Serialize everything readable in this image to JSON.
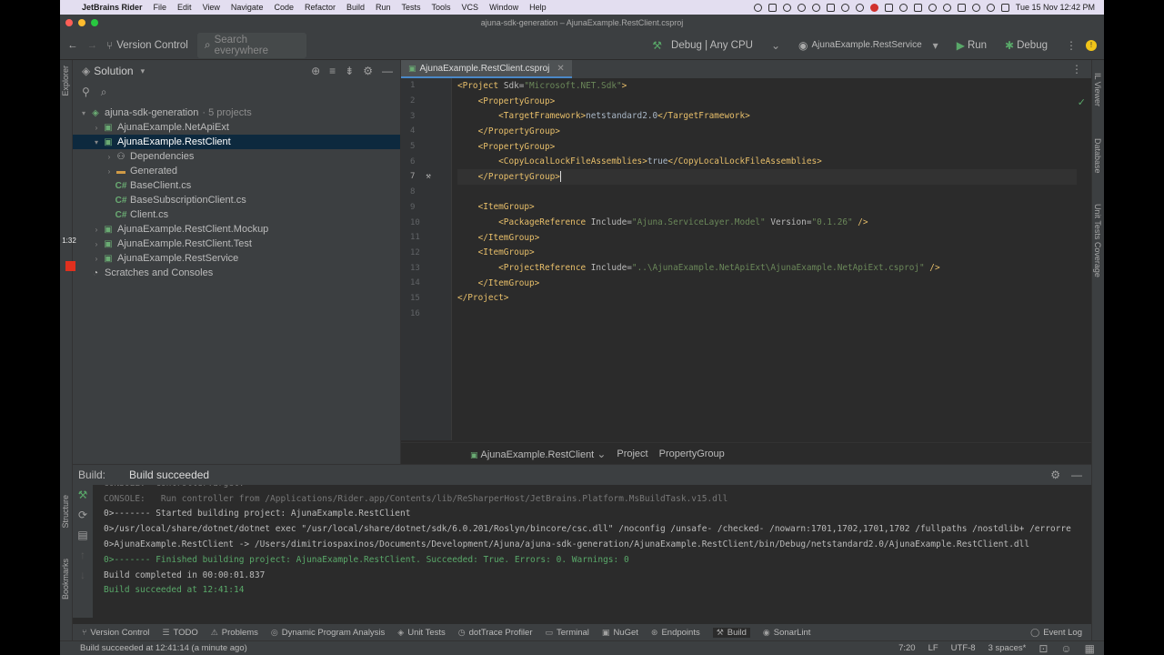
{
  "menubar": {
    "app_name": "JetBrains Rider",
    "items": [
      "File",
      "Edit",
      "View",
      "Navigate",
      "Code",
      "Refactor",
      "Build",
      "Run",
      "Tests",
      "Tools",
      "VCS",
      "Window",
      "Help"
    ],
    "clock": "Tue 15 Nov  12:42 PM"
  },
  "window": {
    "title": "ajuna-sdk-generation – AjunaExample.RestClient.csproj",
    "traffic_colors": [
      "#ff5f57",
      "#febc2e",
      "#28c840"
    ]
  },
  "toolbar": {
    "version_control": "Version Control",
    "search_placeholder": "Search everywhere",
    "config": "Debug | Any CPU",
    "run_target": "AjunaExample.RestService",
    "run_label": "Run",
    "debug_label": "Debug"
  },
  "side_labels": {
    "left_explorer": "Explorer",
    "right": [
      "IL Viewer",
      "Database",
      "Unit Tests Coverage"
    ],
    "build_left": [
      "Structure",
      "Bookmarks"
    ]
  },
  "overlay": {
    "timer": "1:32"
  },
  "project": {
    "header": "Solution",
    "tree": [
      {
        "label": "ajuna-sdk-generation",
        "extra": "· 5 projects",
        "arrow": "▾",
        "icon": "solution-icon",
        "indent": 0
      },
      {
        "label": "AjunaExample.NetApiExt",
        "arrow": "›",
        "icon": "project-icon",
        "indent": 1
      },
      {
        "label": "AjunaExample.RestClient",
        "arrow": "▾",
        "icon": "project-icon",
        "indent": 1,
        "selected": true
      },
      {
        "label": "Dependencies",
        "arrow": "›",
        "icon": "dependencies-icon",
        "indent": 2
      },
      {
        "label": "Generated",
        "arrow": "›",
        "icon": "folder-icon",
        "indent": 2
      },
      {
        "label": "BaseClient.cs",
        "arrow": "",
        "icon": "csharp-file-icon",
        "indent": 2
      },
      {
        "label": "BaseSubscriptionClient.cs",
        "arrow": "",
        "icon": "csharp-file-icon",
        "indent": 2
      },
      {
        "label": "Client.cs",
        "arrow": "",
        "icon": "csharp-file-icon",
        "indent": 2
      },
      {
        "label": "AjunaExample.RestClient.Mockup",
        "arrow": "›",
        "icon": "project-icon",
        "indent": 1
      },
      {
        "label": "AjunaExample.RestClient.Test",
        "arrow": "›",
        "icon": "project-icon",
        "indent": 1
      },
      {
        "label": "AjunaExample.RestService",
        "arrow": "›",
        "icon": "project-icon",
        "indent": 1
      },
      {
        "label": "Scratches and Consoles",
        "arrow": "",
        "icon": "scratches-icon",
        "indent": 0
      }
    ]
  },
  "editor": {
    "tab_label": "AjunaExample.RestClient.csproj",
    "lines": [
      [
        {
          "c": "tag",
          "t": "<Project "
        },
        {
          "c": "attr",
          "t": "Sdk="
        },
        {
          "c": "val",
          "t": "\"Microsoft.NET.Sdk\""
        },
        {
          "c": "tag",
          "t": ">"
        }
      ],
      [
        {
          "c": "txt",
          "t": "    "
        },
        {
          "c": "tag",
          "t": "<PropertyGroup>"
        }
      ],
      [
        {
          "c": "txt",
          "t": "        "
        },
        {
          "c": "tag",
          "t": "<TargetFramework>"
        },
        {
          "c": "txt",
          "t": "netstandard2.0"
        },
        {
          "c": "tag",
          "t": "</TargetFramework>"
        }
      ],
      [
        {
          "c": "txt",
          "t": "    "
        },
        {
          "c": "tag",
          "t": "</PropertyGroup>"
        }
      ],
      [
        {
          "c": "txt",
          "t": "    "
        },
        {
          "c": "tag",
          "t": "<PropertyGroup>"
        }
      ],
      [
        {
          "c": "txt",
          "t": "        "
        },
        {
          "c": "tag",
          "t": "<CopyLocalLockFileAssemblies>"
        },
        {
          "c": "txt",
          "t": "true"
        },
        {
          "c": "tag",
          "t": "</CopyLocalLockFileAssemblies>"
        }
      ],
      [
        {
          "c": "txt",
          "t": "    "
        },
        {
          "c": "tag",
          "t": "</PropertyGroup>"
        }
      ],
      [],
      [
        {
          "c": "txt",
          "t": "    "
        },
        {
          "c": "tag",
          "t": "<ItemGroup>"
        }
      ],
      [
        {
          "c": "txt",
          "t": "        "
        },
        {
          "c": "tag",
          "t": "<PackageReference "
        },
        {
          "c": "attr",
          "t": "Include="
        },
        {
          "c": "val",
          "t": "\"Ajuna.ServiceLayer.Model\""
        },
        {
          "c": "attr",
          "t": " Version="
        },
        {
          "c": "val",
          "t": "\"0.1.26\""
        },
        {
          "c": "tag",
          "t": " />"
        }
      ],
      [
        {
          "c": "txt",
          "t": "    "
        },
        {
          "c": "tag",
          "t": "</ItemGroup>"
        }
      ],
      [
        {
          "c": "txt",
          "t": "    "
        },
        {
          "c": "tag",
          "t": "<ItemGroup>"
        }
      ],
      [
        {
          "c": "txt",
          "t": "        "
        },
        {
          "c": "tag",
          "t": "<ProjectReference "
        },
        {
          "c": "attr",
          "t": "Include="
        },
        {
          "c": "val",
          "t": "\"..\\AjunaExample.NetApiExt\\AjunaExample.NetApiExt.csproj\""
        },
        {
          "c": "tag",
          "t": " />"
        }
      ],
      [
        {
          "c": "txt",
          "t": "    "
        },
        {
          "c": "tag",
          "t": "</ItemGroup>"
        }
      ],
      [
        {
          "c": "tag",
          "t": "</Project>"
        }
      ],
      []
    ],
    "current_line": 7,
    "breadcrumb": [
      "AjunaExample.RestClient",
      "Project",
      "PropertyGroup"
    ]
  },
  "build": {
    "label": "Build:",
    "tab": "Build succeeded",
    "console": [
      {
        "cls": "faded",
        "t": "CONSOLE:  ControllerTarget."
      },
      {
        "cls": "faded",
        "t": "CONSOLE:   Run controller from /Applications/Rider.app/Contents/lib/ReSharperHost/JetBrains.Platform.MsBuildTask.v15.dll"
      },
      {
        "cls": "",
        "t": "0>------- Started building project: AjunaExample.RestClient"
      },
      {
        "cls": "",
        "t": "0>/usr/local/share/dotnet/dotnet exec \"/usr/local/share/dotnet/sdk/6.0.201/Roslyn/bincore/csc.dll\" /noconfig /unsafe- /checked- /nowarn:1701,1702,1701,1702 /fullpaths /nostdlib+ /errorre"
      },
      {
        "cls": "",
        "t": "0>AjunaExample.RestClient -> /Users/dimitriospaxinos/Documents/Development/Ajuna/ajuna-sdk-generation/AjunaExample.RestClient/bin/Debug/netstandard2.0/AjunaExample.RestClient.dll"
      },
      {
        "cls": "green",
        "t": "0>------- Finished building project: AjunaExample.RestClient. Succeeded: True. Errors: 0. Warnings: 0"
      },
      {
        "cls": "",
        "t": "Build completed in 00:00:01.837"
      },
      {
        "cls": "green",
        "t": "Build succeeded at 12:41:14"
      }
    ]
  },
  "tool_tabs": [
    {
      "label": "Version Control",
      "icon": "branch-icon"
    },
    {
      "label": "TODO",
      "icon": "todo-icon"
    },
    {
      "label": "Problems",
      "icon": "problems-icon"
    },
    {
      "label": "Dynamic Program Analysis",
      "icon": "analysis-icon"
    },
    {
      "label": "Unit Tests",
      "icon": "unit-tests-icon"
    },
    {
      "label": "dotTrace Profiler",
      "icon": "profiler-icon"
    },
    {
      "label": "Terminal",
      "icon": "terminal-icon"
    },
    {
      "label": "NuGet",
      "icon": "nuget-icon"
    },
    {
      "label": "Endpoints",
      "icon": "endpoints-icon"
    },
    {
      "label": "Build",
      "icon": "hammer-icon",
      "active": true
    },
    {
      "label": "SonarLint",
      "icon": "sonarlint-icon"
    }
  ],
  "event_log": "Event Log",
  "status": {
    "message": "Build succeeded at 12:41:14 (a minute ago)",
    "position": "7:20",
    "line_sep": "LF",
    "encoding": "UTF-8",
    "indent": "3 spaces*"
  }
}
